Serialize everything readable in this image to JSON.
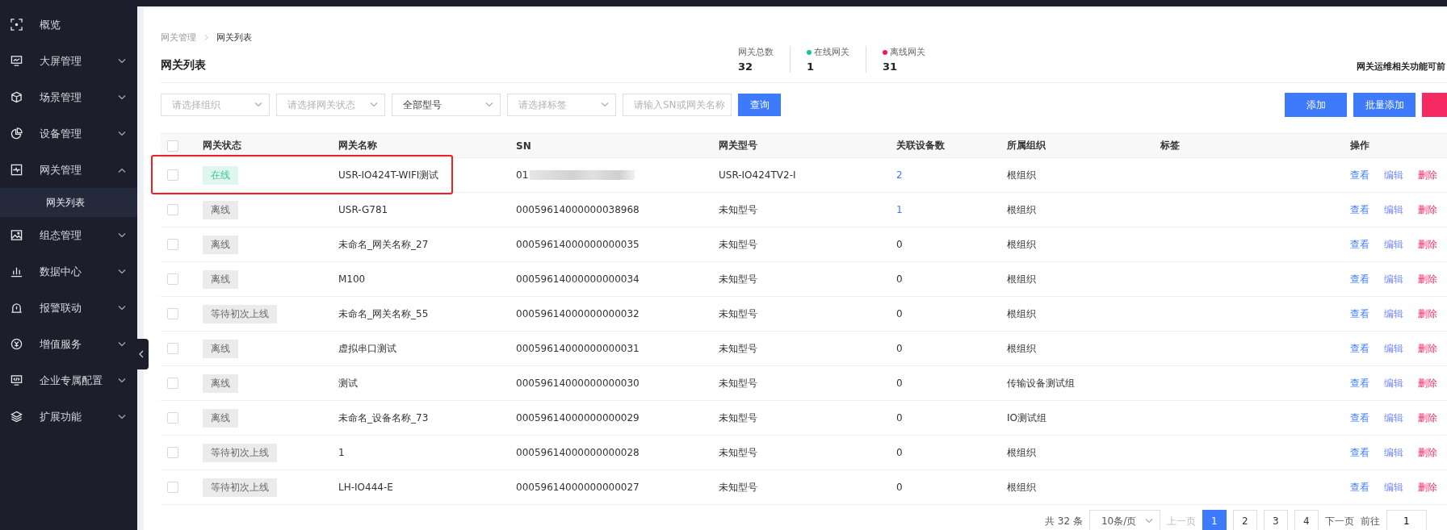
{
  "sidebar": {
    "items": [
      {
        "label": "概览",
        "kind": "single"
      },
      {
        "label": "大屏管理",
        "kind": "group",
        "expanded": false
      },
      {
        "label": "场景管理",
        "kind": "group",
        "expanded": false
      },
      {
        "label": "设备管理",
        "kind": "group",
        "expanded": false
      },
      {
        "label": "网关管理",
        "kind": "group",
        "expanded": true,
        "children": [
          {
            "label": "网关列表",
            "selected": true
          }
        ]
      },
      {
        "label": "组态管理",
        "kind": "group",
        "expanded": false
      },
      {
        "label": "数据中心",
        "kind": "group",
        "expanded": false
      },
      {
        "label": "报警联动",
        "kind": "group",
        "expanded": false
      },
      {
        "label": "增值服务",
        "kind": "group",
        "expanded": false
      },
      {
        "label": "企业专属配置",
        "kind": "group",
        "expanded": false
      },
      {
        "label": "扩展功能",
        "kind": "group",
        "expanded": false
      }
    ]
  },
  "breadcrumb": [
    "网关管理",
    "网关列表"
  ],
  "page_title": "网关列表",
  "stats": [
    {
      "label": "网关总数",
      "value": "32"
    },
    {
      "label": "在线网关",
      "value": "1",
      "color": "#19c39a"
    },
    {
      "label": "离线网关",
      "value": "31",
      "color": "#f5175b"
    }
  ],
  "notice": "网关运维相关功能可前",
  "filters": [
    {
      "placeholder": "请选择组织",
      "kind": "select"
    },
    {
      "placeholder": "请选择网关状态",
      "kind": "select"
    },
    {
      "value": "全部型号",
      "kind": "select"
    },
    {
      "placeholder": "请选择标签",
      "kind": "select"
    },
    {
      "placeholder": "请输入SN或网关名称",
      "kind": "input"
    }
  ],
  "query_button": "查询",
  "actions": [
    {
      "label": "添加",
      "kind": "primary"
    },
    {
      "label": "批量添加",
      "kind": "primary"
    },
    {
      "kind": "danger"
    }
  ],
  "table": {
    "all_checked": false,
    "columns": [
      "网关状态",
      "网关名称",
      "SN",
      "网关型号",
      "关联设备数",
      "所属组织",
      "标签",
      "操作"
    ],
    "rows": [
      {
        "checked": false,
        "highlighted": true,
        "status": "在线",
        "online": true,
        "name": "USR-IO424T-WIFI测试",
        "sn": "01",
        "sn_redacted": true,
        "model": "USR-IO424TV2-I",
        "devices": "2",
        "devices_link": true,
        "org": "根组织",
        "actions": [
          "查看",
          "编辑",
          "删除"
        ]
      },
      {
        "checked": false,
        "highlighted": false,
        "status": "离线",
        "online": false,
        "name": "USR-G781",
        "sn": "00059614000000038968",
        "sn_redacted": false,
        "model": "未知型号",
        "devices": "1",
        "devices_link": true,
        "org": "根组织",
        "actions": [
          "查看",
          "编辑",
          "删除"
        ]
      },
      {
        "checked": false,
        "highlighted": false,
        "status": "离线",
        "online": false,
        "name": "未命名_网关名称_27",
        "sn": "00059614000000000035",
        "sn_redacted": false,
        "model": "未知型号",
        "devices": "0",
        "devices_link": false,
        "org": "根组织",
        "actions": [
          "查看",
          "编辑",
          "删除"
        ]
      },
      {
        "checked": false,
        "highlighted": false,
        "status": "离线",
        "online": false,
        "name": "M100",
        "sn": "00059614000000000034",
        "sn_redacted": false,
        "model": "未知型号",
        "devices": "0",
        "devices_link": false,
        "org": "根组织",
        "actions": [
          "查看",
          "编辑",
          "删除"
        ]
      },
      {
        "checked": false,
        "highlighted": false,
        "status": "等待初次上线",
        "online": false,
        "name": "未命名_网关名称_55",
        "sn": "00059614000000000032",
        "sn_redacted": false,
        "model": "未知型号",
        "devices": "0",
        "devices_link": false,
        "org": "根组织",
        "actions": [
          "查看",
          "编辑",
          "删除"
        ]
      },
      {
        "checked": false,
        "highlighted": false,
        "status": "离线",
        "online": false,
        "name": "虚拟串口测试",
        "sn": "00059614000000000031",
        "sn_redacted": false,
        "model": "未知型号",
        "devices": "0",
        "devices_link": false,
        "org": "根组织",
        "actions": [
          "查看",
          "编辑",
          "删除"
        ]
      },
      {
        "checked": false,
        "highlighted": false,
        "status": "离线",
        "online": false,
        "name": "测试",
        "sn": "00059614000000000030",
        "sn_redacted": false,
        "model": "未知型号",
        "devices": "0",
        "devices_link": false,
        "org": "传输设备测试组",
        "actions": [
          "查看",
          "编辑",
          "删除"
        ]
      },
      {
        "checked": false,
        "highlighted": false,
        "status": "离线",
        "online": false,
        "name": "未命名_设备名称_73",
        "sn": "00059614000000000029",
        "sn_redacted": false,
        "model": "未知型号",
        "devices": "0",
        "devices_link": false,
        "org": "IO测试组",
        "actions": [
          "查看",
          "编辑",
          "删除"
        ]
      },
      {
        "checked": false,
        "highlighted": false,
        "status": "等待初次上线",
        "online": false,
        "name": "1",
        "sn": "00059614000000000028",
        "sn_redacted": false,
        "model": "未知型号",
        "devices": "0",
        "devices_link": false,
        "org": "根组织",
        "actions": [
          "查看",
          "编辑",
          "删除"
        ]
      },
      {
        "checked": false,
        "highlighted": false,
        "status": "等待初次上线",
        "online": false,
        "name": "LH-IO444-E",
        "sn": "00059614000000000027",
        "sn_redacted": false,
        "model": "未知型号",
        "devices": "0",
        "devices_link": false,
        "org": "根组织",
        "actions": [
          "查看",
          "编辑",
          "删除"
        ]
      }
    ]
  },
  "pagination": {
    "total": "共 32 条",
    "page_size": "10条/页",
    "prev": "上一页",
    "pages": [
      {
        "label": "1",
        "selected": true
      },
      {
        "label": "2",
        "selected": false
      },
      {
        "label": "3",
        "selected": false
      },
      {
        "label": "4",
        "selected": false
      }
    ],
    "next": "下一页",
    "goto": "前往",
    "goto_value": "1"
  }
}
